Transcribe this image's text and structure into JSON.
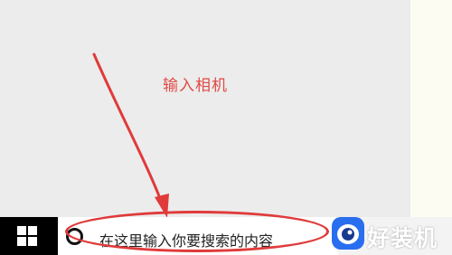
{
  "annotation": {
    "text": "输入相机"
  },
  "taskbar": {
    "start_icon": "windows-logo-icon",
    "search": {
      "icon": "cortana-circle-icon",
      "placeholder": "在这里输入你要搜索的内容"
    }
  },
  "watermark": {
    "text": "好装机",
    "logo_icon": "eye-logo-icon"
  },
  "colors": {
    "annotation_red": "#e04a44",
    "taskbar_bg": "#f3f3f3",
    "start_bg": "#000000",
    "desktop_bg": "#ececec",
    "watermark_blue": "#2a6ef0"
  }
}
